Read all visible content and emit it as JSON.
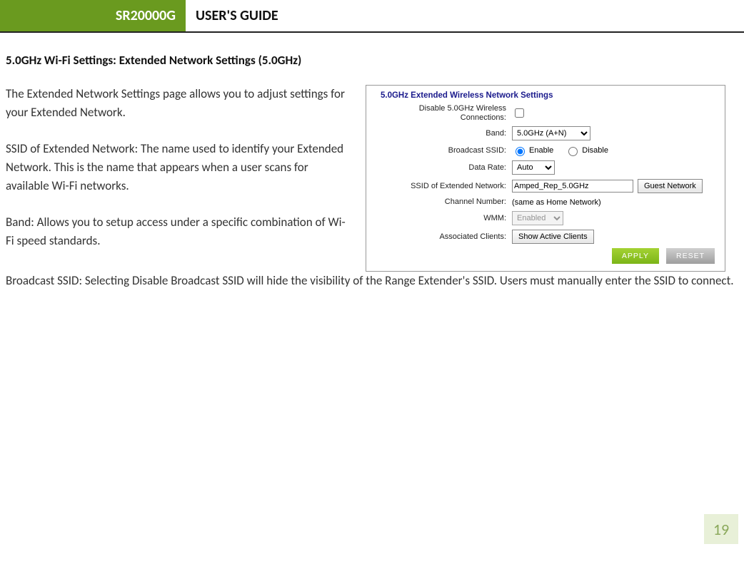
{
  "header": {
    "model": "SR20000G",
    "title": "USER'S GUIDE"
  },
  "section_heading": "5.0GHz Wi-Fi Settings: Extended Network Settings (5.0GHz)",
  "paragraphs": {
    "intro": "The Extended Network Settings page allows you to adjust settings for your Extended Network.",
    "ssid": "SSID of Extended Network: The name used to identify your Extended Network. This is the name that appears when a user scans for available Wi-Fi networks.",
    "band": "Band: Allows you to setup access under a specific combination of Wi-Fi speed standards.",
    "broadcast": "Broadcast SSID: Selecting Disable Broadcast SSID will hide the visibility of the Range Extender's SSID. Users must manually enter the SSID to connect."
  },
  "panel": {
    "title": "5.0GHz Extended Wireless Network Settings",
    "labels": {
      "disable": "Disable 5.0GHz Wireless Connections:",
      "band": "Band:",
      "broadcast": "Broadcast SSID:",
      "rate": "Data Rate:",
      "ssid": "SSID of Extended Network:",
      "channel": "Channel Number:",
      "wmm": "WMM:",
      "clients": "Associated Clients:"
    },
    "values": {
      "band": "5.0GHz (A+N)",
      "rate": "Auto",
      "ssid": "Amped_Rep_5.0GHz",
      "channel_text": "(same as Home Network)",
      "wmm": "Enabled"
    },
    "radio": {
      "enable": "Enable",
      "disable": "Disable"
    },
    "buttons": {
      "guest": "Guest Network",
      "show_clients": "Show Active Clients",
      "apply": "APPLY",
      "reset": "RESET"
    }
  },
  "page_number": "19"
}
